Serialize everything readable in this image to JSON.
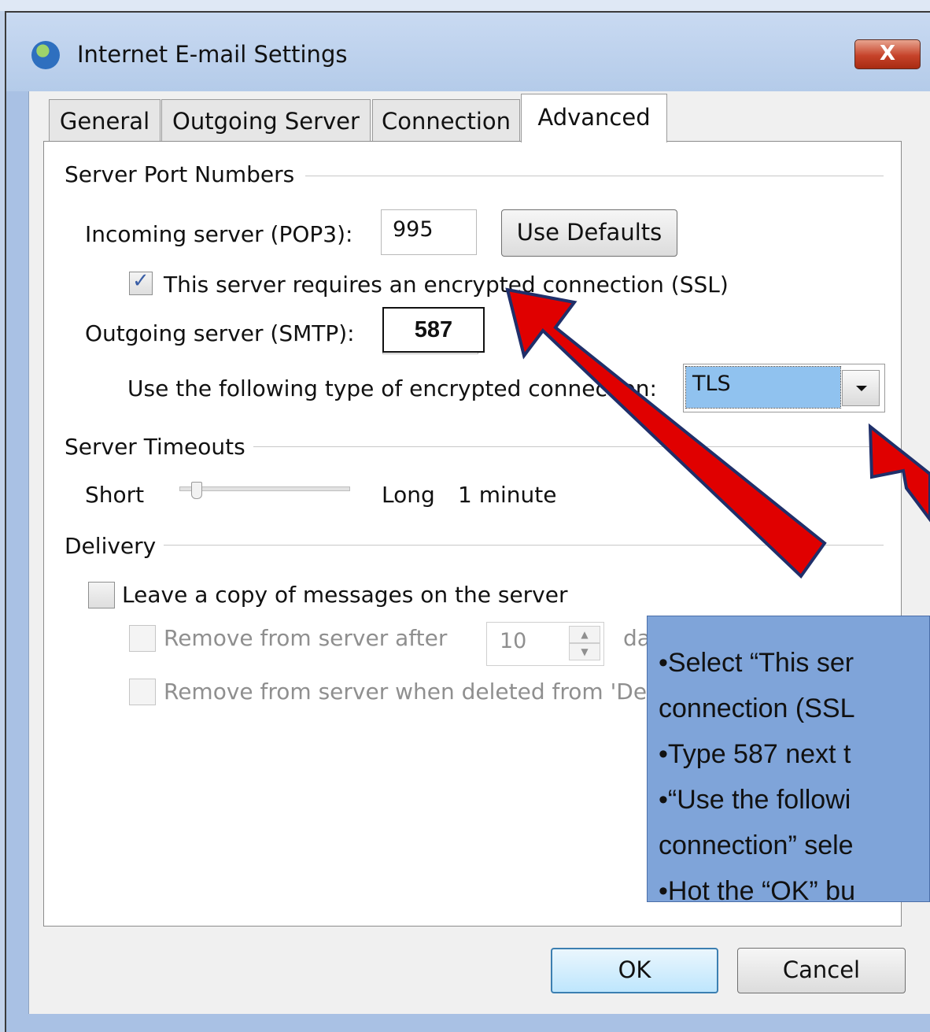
{
  "dialog": {
    "title": "Internet E-mail Settings",
    "close_label": "X"
  },
  "tabs": [
    {
      "label": "General",
      "active": false
    },
    {
      "label": "Outgoing Server",
      "active": false
    },
    {
      "label": "Connection",
      "active": false
    },
    {
      "label": "Advanced",
      "active": true
    }
  ],
  "port_numbers": {
    "section_title": "Server Port Numbers",
    "incoming_label": "Incoming server (POP3):",
    "incoming_value": "995",
    "use_defaults_label": "Use Defaults",
    "ssl_checkbox_label": "This server requires an encrypted connection (SSL)",
    "ssl_checked": true,
    "outgoing_label": "Outgoing server (SMTP):",
    "outgoing_value": "587",
    "encryption_label": "Use the following type of encrypted connection:",
    "encryption_value": "TLS"
  },
  "timeouts": {
    "section_title": "Server Timeouts",
    "short_label": "Short",
    "long_label": "Long",
    "value_label": "1 minute",
    "slider_level": 0.07
  },
  "delivery": {
    "section_title": "Delivery",
    "leave_copy_label": "Leave a copy of messages on the server",
    "leave_copy_checked": false,
    "remove_after_label": "Remove from server after",
    "remove_after_days": "10",
    "days_label": "da",
    "remove_deleted_label": "Remove from server when deleted from 'De"
  },
  "annotation": {
    "lines": [
      "•Select “This ser",
      "connection (SSL",
      "•Type 587 next t",
      "•“Use the followi",
      "connection” sele",
      "•Hot the “OK” bu"
    ],
    "arrow_color": "#e00000"
  },
  "footer": {
    "ok_label": "OK",
    "cancel_label": "Cancel"
  }
}
